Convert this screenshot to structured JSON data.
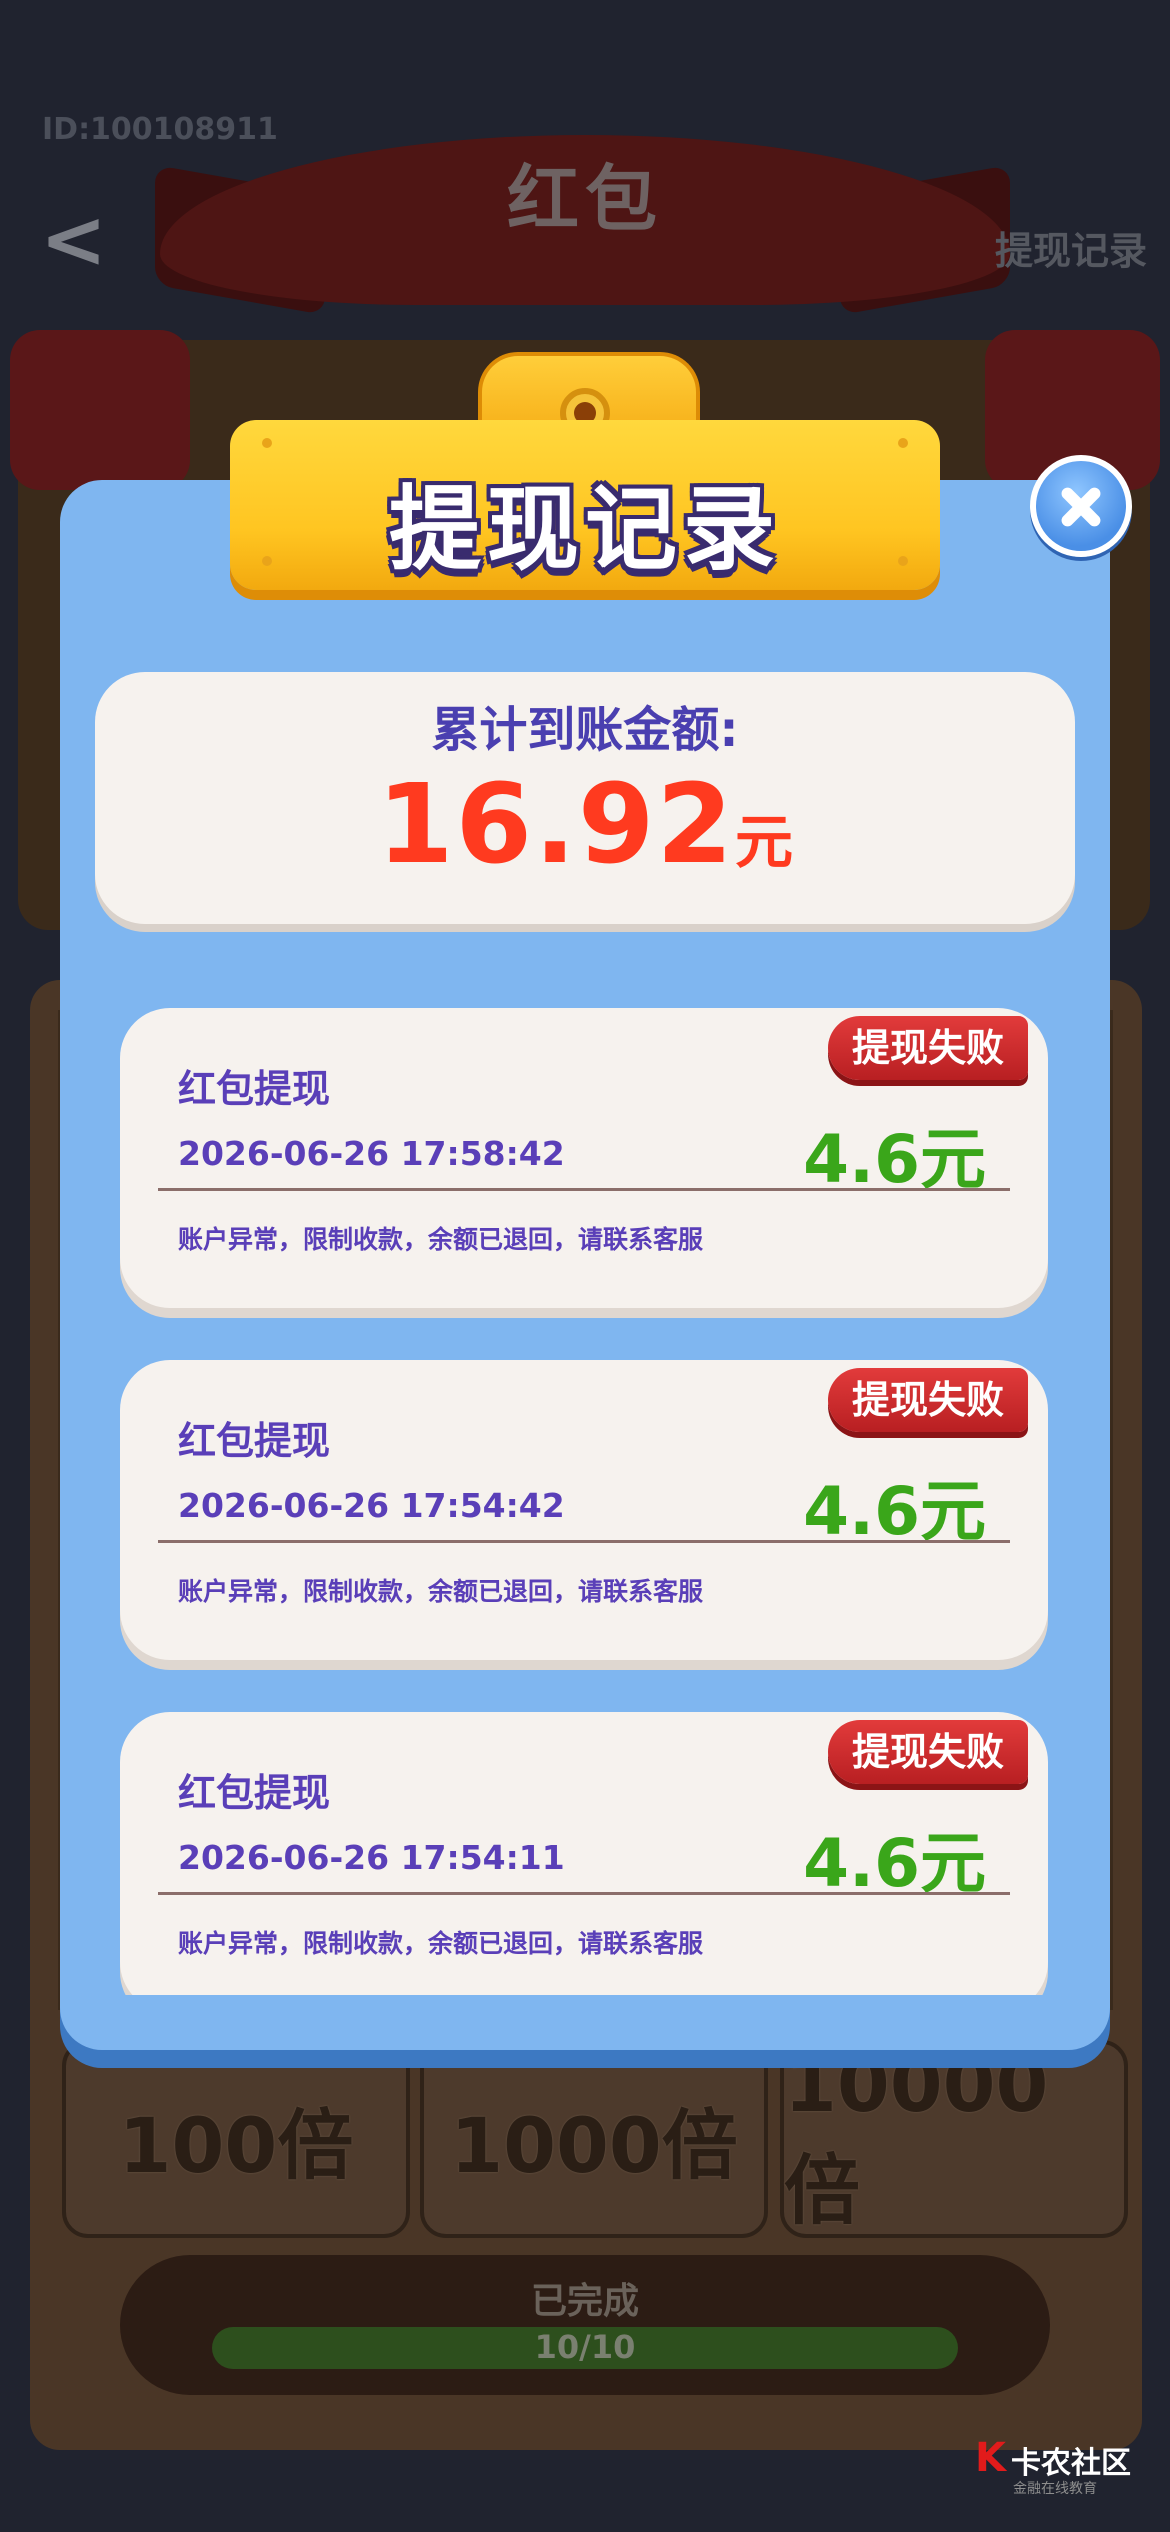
{
  "background": {
    "user_id": "ID:100108911",
    "back_glyph": "<",
    "title": "红包",
    "top_right_link": "提现记录",
    "multipliers": [
      "100倍",
      "1000倍",
      "10000倍"
    ],
    "progress_label": "已完成",
    "progress_text": "10/10",
    "progress_value": 1.0
  },
  "modal": {
    "title": "提现记录",
    "close_icon": "close-icon",
    "summary": {
      "label": "累计到账金额:",
      "amount": "16.92",
      "unit": "元"
    },
    "records": [
      {
        "title": "红包提现",
        "time": "2026-06-26 17:58:42",
        "amount": "4.6元",
        "status": "提现失败",
        "note": "账户异常，限制收款，余额已退回，请联系客服"
      },
      {
        "title": "红包提现",
        "time": "2026-06-26 17:54:42",
        "amount": "4.6元",
        "status": "提现失败",
        "note": "账户异常，限制收款，余额已退回，请联系客服"
      },
      {
        "title": "红包提现",
        "time": "2026-06-26 17:54:11",
        "amount": "4.6元",
        "status": "提现失败",
        "note": "账户异常，限制收款，余额已退回，请联系客服"
      }
    ]
  },
  "watermark": {
    "name": "卡农社区",
    "sub": "金融在线教育"
  },
  "colors": {
    "modal_bg": "#7fb6f0",
    "header_gold": "#ffc521",
    "amount_red": "#ff3a1f",
    "amount_green": "#3aa61a",
    "text_purple": "#5a3fb8",
    "badge_red": "#c8272a"
  }
}
